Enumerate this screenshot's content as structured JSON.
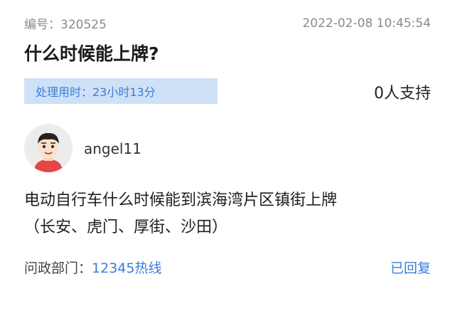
{
  "meta": {
    "number_label": "编号：",
    "number": "320525",
    "datetime": "2022-02-08 10:45:54"
  },
  "title": "什么时候能上牌?",
  "handling": {
    "label": "处理用时：",
    "value": "23小时13分"
  },
  "support_text": "0人支持",
  "user": {
    "avatar_icon": "person-avatar-icon",
    "name": "angel11"
  },
  "content": {
    "line1": "电动自行车什么时候能到滨海湾片区镇街上牌",
    "line2": "（长安、虎门、厚街、沙田）"
  },
  "department": {
    "label": "问政部门：",
    "value": "12345热线"
  },
  "status": "已回复",
  "colors": {
    "accent": "#3b7dd8",
    "badge_bg": "#cfe1f7",
    "meta_gray": "#8a8a8a"
  }
}
